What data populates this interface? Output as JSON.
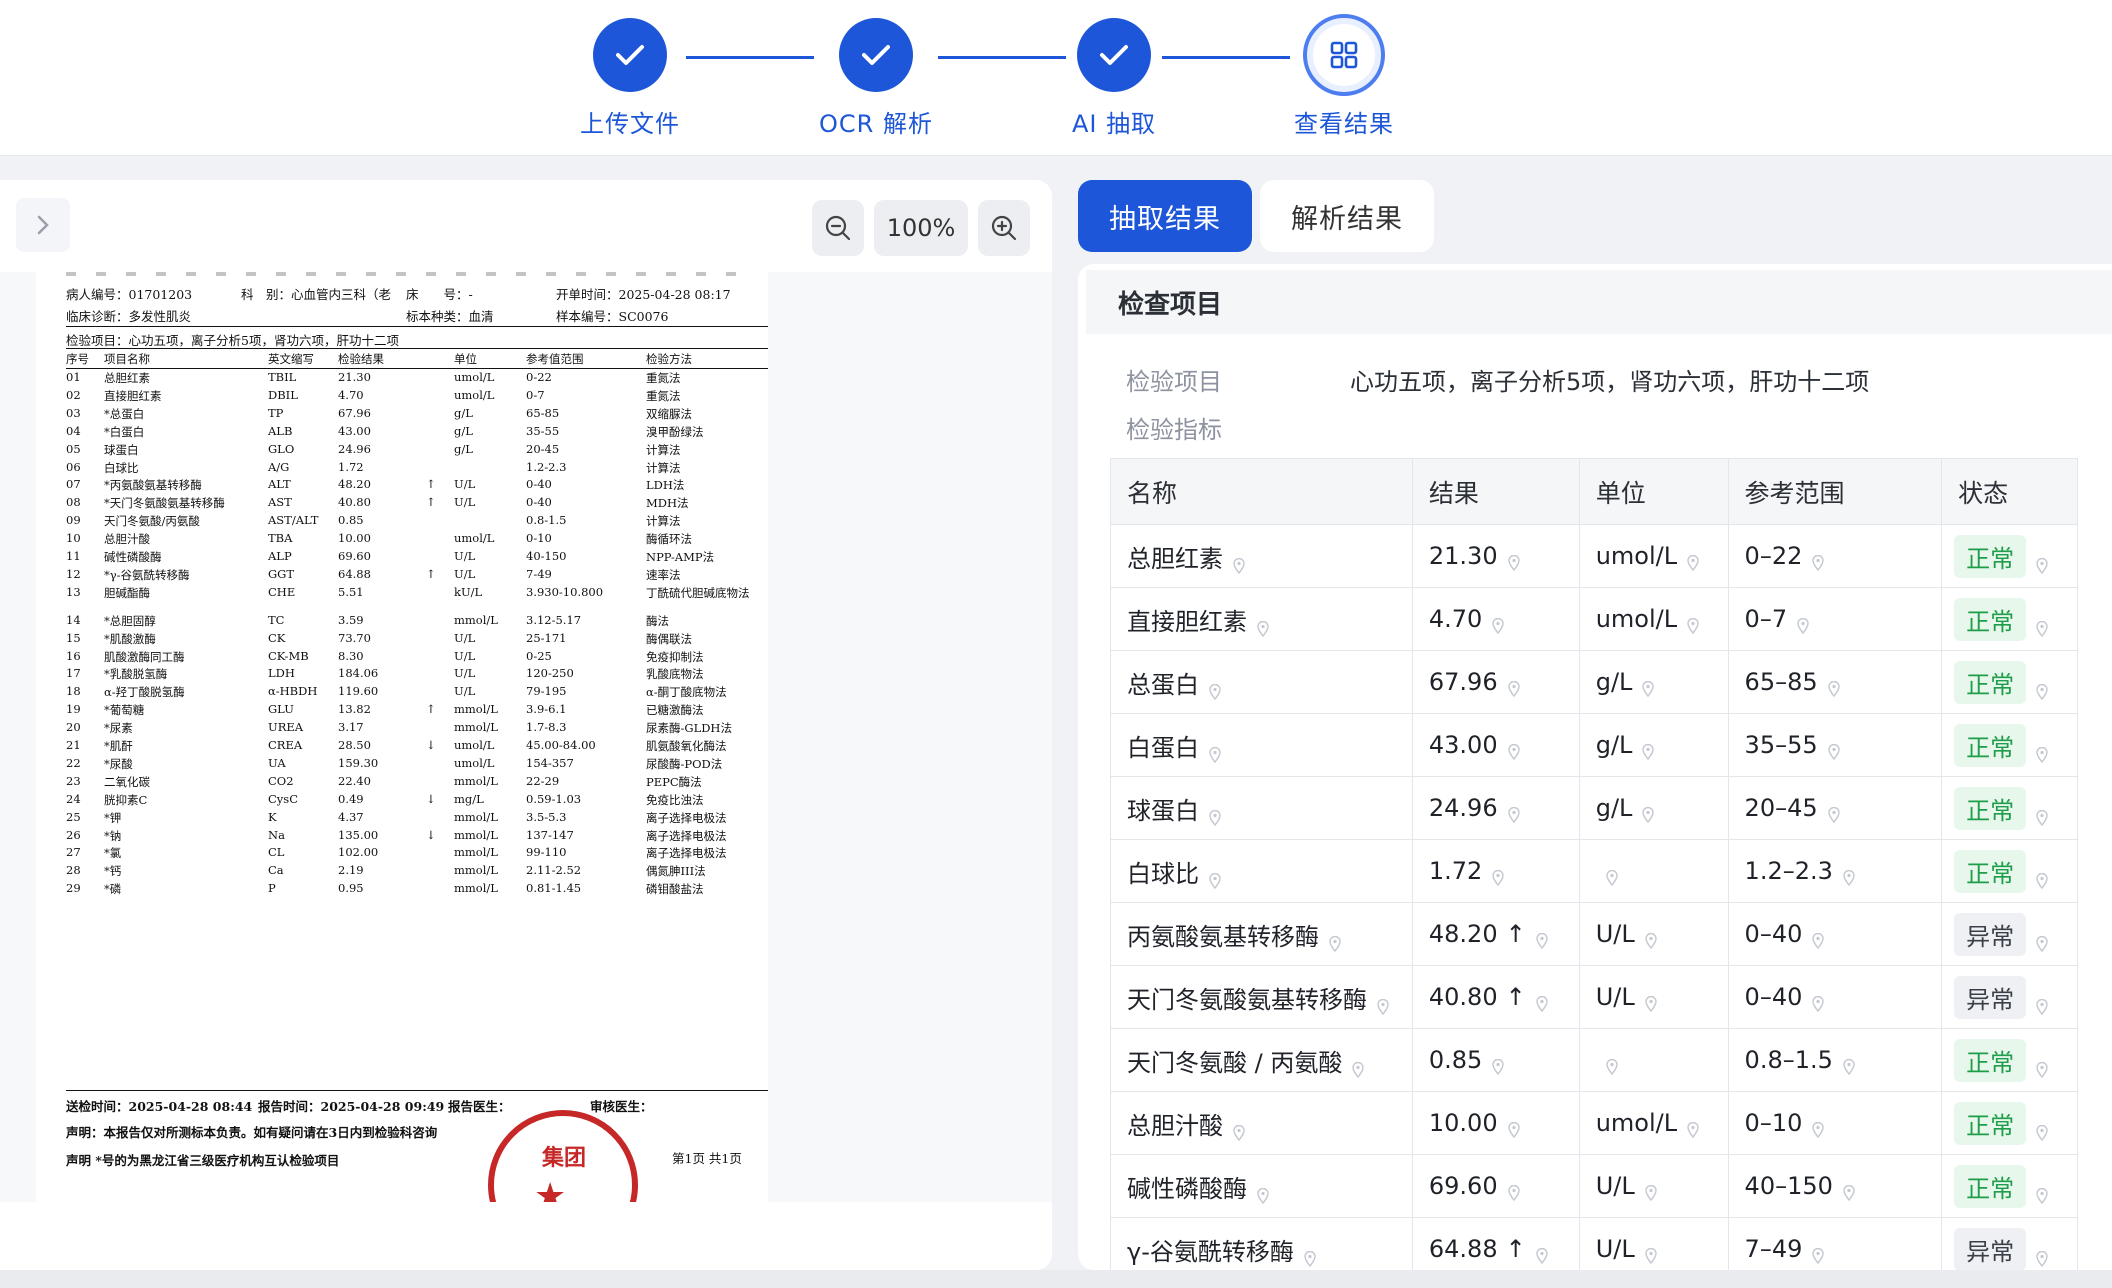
{
  "stepper": {
    "steps": [
      {
        "label": "上传文件",
        "state": "done"
      },
      {
        "label": "OCR 解析",
        "state": "done"
      },
      {
        "label": "AI 抽取",
        "state": "done"
      },
      {
        "label": "查看结果",
        "state": "current"
      }
    ],
    "accent": "#1d56d8"
  },
  "viewer": {
    "zoom": "100%",
    "document": {
      "header": {
        "patient_id": "病人编号：01701203",
        "dept": "科　别：心血管内三科（老",
        "bed": "床　　号：-",
        "order_time": "开单时间：2025-04-28 08:17",
        "diagnosis": "临床诊断：多发性肌炎",
        "specimen_type": "标本种类：血清",
        "specimen_no": "样本编号：SC0076",
        "items": "检验项目：心功五项，离子分析5项，肾功六项，肝功十二项"
      },
      "columns": [
        "序号",
        "项目名称",
        "英文缩写",
        "检验结果",
        "单位",
        "参考值范围",
        "检验方法"
      ],
      "rows": [
        [
          "01",
          "总胆红素",
          "TBIL",
          "21.30",
          "",
          "umol/L",
          "0-22",
          "重氮法"
        ],
        [
          "02",
          "直接胆红素",
          "DBIL",
          "4.70",
          "",
          "umol/L",
          "0-7",
          "重氮法"
        ],
        [
          "03",
          "*总蛋白",
          "TP",
          "67.96",
          "",
          "g/L",
          "65-85",
          "双缩脲法"
        ],
        [
          "04",
          "*白蛋白",
          "ALB",
          "43.00",
          "",
          "g/L",
          "35-55",
          "溴甲酚绿法"
        ],
        [
          "05",
          "球蛋白",
          "GLO",
          "24.96",
          "",
          "g/L",
          "20-45",
          "计算法"
        ],
        [
          "06",
          "白球比",
          "A/G",
          "1.72",
          "",
          "",
          "1.2-2.3",
          "计算法"
        ],
        [
          "07",
          "*丙氨酸氨基转移酶",
          "ALT",
          "48.20",
          "↑",
          "U/L",
          "0-40",
          "LDH法"
        ],
        [
          "08",
          "*天门冬氨酸氨基转移酶",
          "AST",
          "40.80",
          "↑",
          "U/L",
          "0-40",
          "MDH法"
        ],
        [
          "09",
          "天门冬氨酸/丙氨酸",
          "AST/ALT",
          "0.85",
          "",
          "",
          "0.8-1.5",
          "计算法"
        ],
        [
          "10",
          "总胆汁酸",
          "TBA",
          "10.00",
          "",
          "umol/L",
          "0-10",
          "酶循环法"
        ],
        [
          "11",
          "碱性磷酸酶",
          "ALP",
          "69.60",
          "",
          "U/L",
          "40-150",
          "NPP-AMP法"
        ],
        [
          "12",
          "*γ-谷氨酰转移酶",
          "GGT",
          "64.88",
          "↑",
          "U/L",
          "7-49",
          "速率法"
        ],
        [
          "13",
          "胆碱酯酶",
          "CHE",
          "5.51",
          "",
          "kU/L",
          "3.930-10.800",
          "丁酰硫代胆碱底物法"
        ],
        [
          "14",
          "*总胆固醇",
          "TC",
          "3.59",
          "",
          "mmol/L",
          "3.12-5.17",
          "酶法"
        ],
        [
          "15",
          "*肌酸激酶",
          "CK",
          "73.70",
          "",
          "U/L",
          "25-171",
          "酶偶联法"
        ],
        [
          "16",
          "肌酸激酶同工酶",
          "CK-MB",
          "8.30",
          "",
          "U/L",
          "0-25",
          "免疫抑制法"
        ],
        [
          "17",
          "*乳酸脱氢酶",
          "LDH",
          "184.06",
          "",
          "U/L",
          "120-250",
          "乳酸底物法"
        ],
        [
          "18",
          "α-羟丁酸脱氢酶",
          "α-HBDH",
          "119.60",
          "",
          "U/L",
          "79-195",
          "α-酮丁酸底物法"
        ],
        [
          "19",
          "*葡萄糖",
          "GLU",
          "13.82",
          "↑",
          "mmol/L",
          "3.9-6.1",
          "已糖激酶法"
        ],
        [
          "20",
          "*尿素",
          "UREA",
          "3.17",
          "",
          "mmol/L",
          "1.7-8.3",
          "尿素酶-GLDH法"
        ],
        [
          "21",
          "*肌酐",
          "CREA",
          "28.50",
          "↓",
          "umol/L",
          "45.00-84.00",
          "肌氨酸氧化酶法"
        ],
        [
          "22",
          "*尿酸",
          "UA",
          "159.30",
          "",
          "umol/L",
          "154-357",
          "尿酸酶-POD法"
        ],
        [
          "23",
          "二氧化碳",
          "CO2",
          "22.40",
          "",
          "mmol/L",
          "22-29",
          "PEPC酶法"
        ],
        [
          "24",
          "胱抑素C",
          "CysC",
          "0.49",
          "↓",
          "mg/L",
          "0.59-1.03",
          "免疫比浊法"
        ],
        [
          "25",
          "*钾",
          "K",
          "4.37",
          "",
          "mmol/L",
          "3.5-5.3",
          "离子选择电极法"
        ],
        [
          "26",
          "*钠",
          "Na",
          "135.00",
          "↓",
          "mmol/L",
          "137-147",
          "离子选择电极法"
        ],
        [
          "27",
          "*氯",
          "CL",
          "102.00",
          "",
          "mmol/L",
          "99-110",
          "离子选择电极法"
        ],
        [
          "28",
          "*钙",
          "Ca",
          "2.19",
          "",
          "mmol/L",
          "2.11-2.52",
          "偶氮胂III法"
        ],
        [
          "29",
          "*磷",
          "P",
          "0.95",
          "",
          "mmol/L",
          "0.81-1.45",
          "磷钼酸盐法"
        ]
      ],
      "footer": {
        "send_time": "送检时间：2025-04-28 08:44",
        "report_time": "报告时间：2025-04-28 09:49",
        "report_doctor": "报告医生：",
        "reviewer": "审核医生：",
        "statement1": "声明：本报告仅对所测标本负责。如有疑问请在3日内到检验科咨询",
        "statement2": "声明 *号的为黑龙江省三级医疗机构互认检验项目",
        "page": "第1页 共1页",
        "stamp_text": "集团"
      }
    }
  },
  "result": {
    "tabs": [
      {
        "label": "抽取结果",
        "active": true
      },
      {
        "label": "解析结果",
        "active": false
      }
    ],
    "section_title": "检查项目",
    "field_label_items": "检验项目",
    "field_value_items": "心功五项，离子分析5项，肾功六项，肝功十二项",
    "field_label_indicators": "检验指标",
    "table_headers": [
      "名称",
      "结果",
      "单位",
      "参考范围",
      "状态"
    ],
    "rows": [
      {
        "name": "总胆红素",
        "value": "21.30",
        "arrow": "",
        "unit": "umol/L",
        "range": "0–22",
        "status": "正常",
        "normal": true
      },
      {
        "name": "直接胆红素",
        "value": "4.70",
        "arrow": "",
        "unit": "umol/L",
        "range": "0–7",
        "status": "正常",
        "normal": true
      },
      {
        "name": "总蛋白",
        "value": "67.96",
        "arrow": "",
        "unit": "g/L",
        "range": "65–85",
        "status": "正常",
        "normal": true
      },
      {
        "name": "白蛋白",
        "value": "43.00",
        "arrow": "",
        "unit": "g/L",
        "range": "35–55",
        "status": "正常",
        "normal": true
      },
      {
        "name": "球蛋白",
        "value": "24.96",
        "arrow": "",
        "unit": "g/L",
        "range": "20–45",
        "status": "正常",
        "normal": true
      },
      {
        "name": "白球比",
        "value": "1.72",
        "arrow": "",
        "unit": "",
        "range": "1.2–2.3",
        "status": "正常",
        "normal": true
      },
      {
        "name": "丙氨酸氨基转移酶",
        "value": "48.20",
        "arrow": "↑",
        "unit": "U/L",
        "range": "0–40",
        "status": "异常",
        "normal": false
      },
      {
        "name": "天门冬氨酸氨基转移酶",
        "value": "40.80",
        "arrow": "↑",
        "unit": "U/L",
        "range": "0–40",
        "status": "异常",
        "normal": false
      },
      {
        "name": "天门冬氨酸 / 丙氨酸",
        "value": "0.85",
        "arrow": "",
        "unit": "",
        "range": "0.8–1.5",
        "status": "正常",
        "normal": true
      },
      {
        "name": "总胆汁酸",
        "value": "10.00",
        "arrow": "",
        "unit": "umol/L",
        "range": "0–10",
        "status": "正常",
        "normal": true
      },
      {
        "name": "碱性磷酸酶",
        "value": "69.60",
        "arrow": "",
        "unit": "U/L",
        "range": "40–150",
        "status": "正常",
        "normal": true
      },
      {
        "name": "γ-谷氨酰转移酶",
        "value": "64.88",
        "arrow": "↑",
        "unit": "U/L",
        "range": "7–49",
        "status": "异常",
        "normal": false
      }
    ]
  }
}
